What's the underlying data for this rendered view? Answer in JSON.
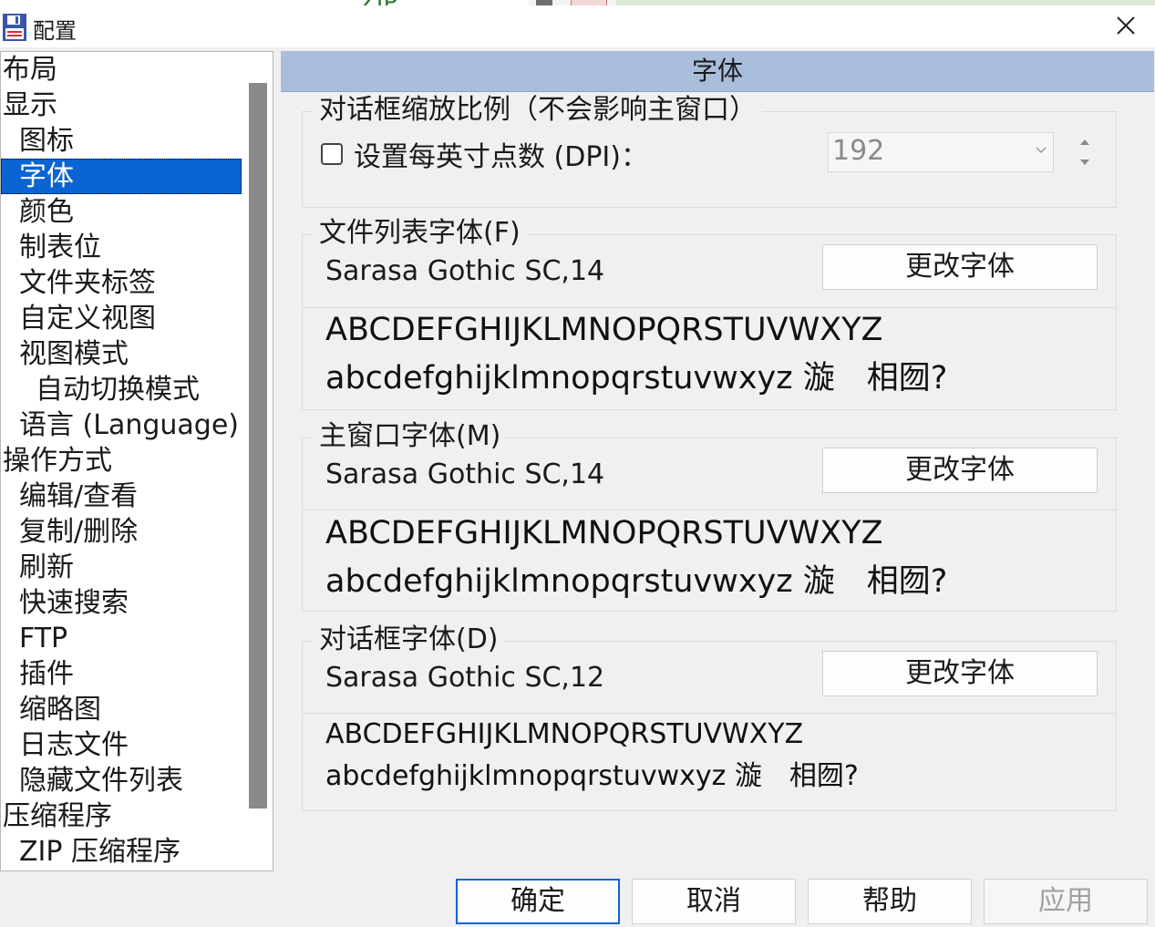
{
  "window": {
    "title": "配置"
  },
  "background": {
    "fragment": "ZIP"
  },
  "tree": {
    "items": [
      {
        "label": "布局",
        "level": 0
      },
      {
        "label": "显示",
        "level": 0
      },
      {
        "label": "图标",
        "level": 1
      },
      {
        "label": "字体",
        "level": 1,
        "selected": true
      },
      {
        "label": "颜色",
        "level": 1
      },
      {
        "label": "制表位",
        "level": 1
      },
      {
        "label": "文件夹标签",
        "level": 1
      },
      {
        "label": "自定义视图",
        "level": 1
      },
      {
        "label": "视图模式",
        "level": 1
      },
      {
        "label": "自动切换模式",
        "level": 2
      },
      {
        "label": "语言 (Language)",
        "level": 1
      },
      {
        "label": "操作方式",
        "level": 0
      },
      {
        "label": "编辑/查看",
        "level": 1
      },
      {
        "label": "复制/删除",
        "level": 1
      },
      {
        "label": "刷新",
        "level": 1
      },
      {
        "label": "快速搜索",
        "level": 1
      },
      {
        "label": "FTP",
        "level": 1
      },
      {
        "label": "插件",
        "level": 1
      },
      {
        "label": "缩略图",
        "level": 1
      },
      {
        "label": "日志文件",
        "level": 1
      },
      {
        "label": "隐藏文件列表",
        "level": 1
      },
      {
        "label": "压缩程序",
        "level": 0
      },
      {
        "label": "ZIP 压缩程序",
        "level": 1
      }
    ]
  },
  "panel": {
    "header": "字体",
    "dialog_scale": {
      "legend": "对话框缩放比例（不会影响主窗口）",
      "checkbox_label": "设置每英寸点数 (DPI)：",
      "checked": false,
      "dpi_value": "192"
    },
    "file_list_font": {
      "legend": "文件列表字体(F)",
      "font": "Sarasa Gothic SC,14",
      "button": "更改字体",
      "sample_upper": "ABCDEFGHIJKLMNOPQRSTUVWXYZ",
      "sample_lower": "abcdefghijklmnopqrstuvwxyz 漩　相囫?"
    },
    "main_window_font": {
      "legend": "主窗口字体(M)",
      "font": "Sarasa Gothic SC,14",
      "button": "更改字体",
      "sample_upper": "ABCDEFGHIJKLMNOPQRSTUVWXYZ",
      "sample_lower": "abcdefghijklmnopqrstuvwxyz 漩　相囫?"
    },
    "dialog_font": {
      "legend": "对话框字体(D)",
      "font": "Sarasa Gothic SC,12",
      "button": "更改字体",
      "sample_upper": "ABCDEFGHIJKLMNOPQRSTUVWXYZ",
      "sample_lower": "abcdefghijklmnopqrstuvwxyz 漩　相囫?"
    }
  },
  "buttons": {
    "ok": "确定",
    "cancel": "取消",
    "help": "帮助",
    "apply": "应用"
  },
  "colors": {
    "selection": "#0a64d2",
    "header_bg": "#a8bedb"
  }
}
